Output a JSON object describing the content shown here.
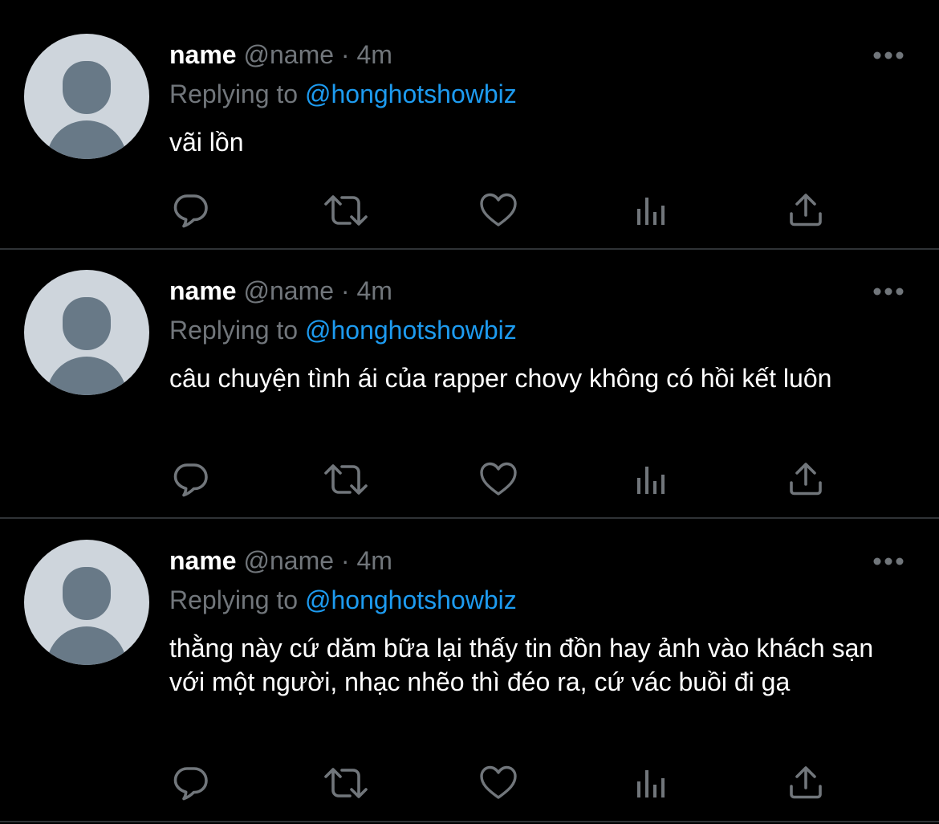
{
  "tweets": [
    {
      "name": "name",
      "handle": "@name",
      "separator": "·",
      "time": "4m",
      "replying_prefix": "Replying to",
      "replying_to": "@honghotshowbiz",
      "text": "vãi lồn"
    },
    {
      "name": "name",
      "handle": "@name",
      "separator": "·",
      "time": "4m",
      "replying_prefix": "Replying to",
      "replying_to": "@honghotshowbiz",
      "text": "câu chuyện tình ái của rapper chovy không có hồi kết luôn"
    },
    {
      "name": "name",
      "handle": "@name",
      "separator": "·",
      "time": "4m",
      "replying_prefix": "Replying to",
      "replying_to": "@honghotshowbiz",
      "text": "thằng này cứ dăm bữa lại thấy tin đồn hay ảnh vào khách sạn với một người, nhạc nhẽo thì đéo ra, cứ vác buồi đi gạ"
    }
  ],
  "icons": {
    "more": "more-horizontal-icon",
    "reply": "reply-bubble-icon",
    "retweet": "retweet-icon",
    "like": "heart-icon",
    "views": "analytics-bars-icon",
    "share": "share-upload-icon"
  },
  "colors": {
    "background": "#000000",
    "text": "#ffffff",
    "secondary": "#71767b",
    "accent": "#1d9bf0",
    "divider": "#2f3336",
    "avatar_bg": "#ced5dc",
    "avatar_fg": "#687987"
  }
}
